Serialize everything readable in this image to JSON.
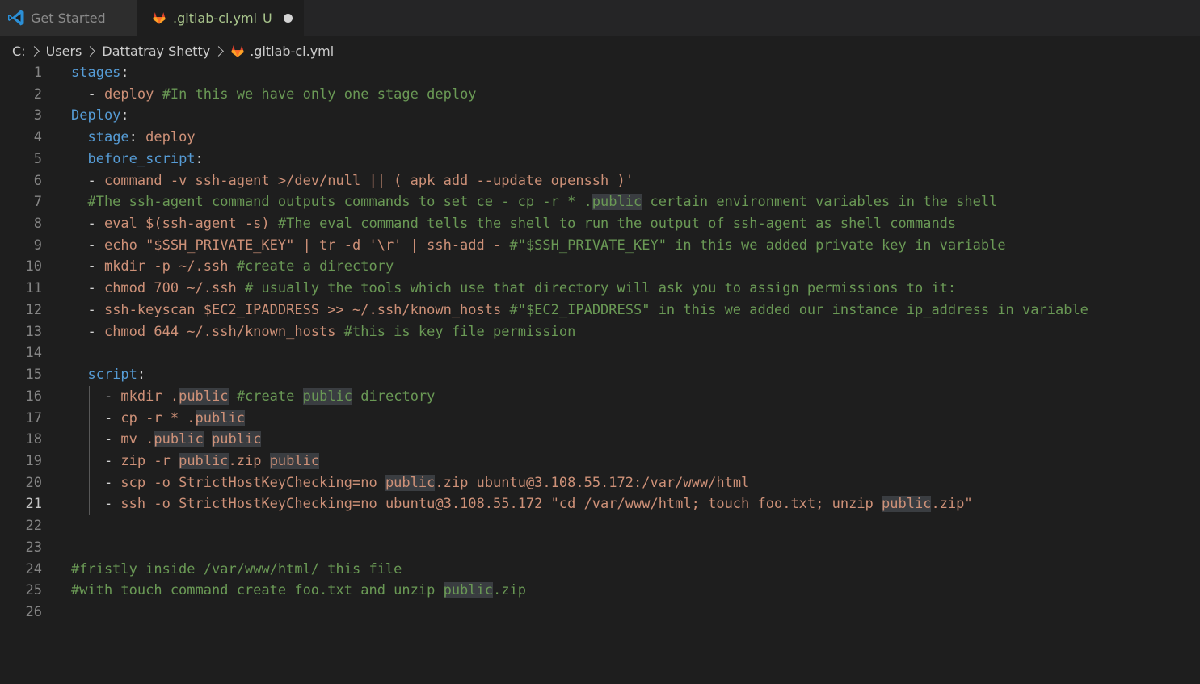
{
  "tabs": [
    {
      "label": "Get Started",
      "active": false,
      "icon": "vscode-icon"
    },
    {
      "label": ".gitlab-ci.yml",
      "status": "U",
      "dirty": true,
      "active": true,
      "icon": "gitlab-icon"
    }
  ],
  "breadcrumb": [
    ".C:",
    "Users",
    "Dattatray Shetty",
    ".gitlab-ci.yml"
  ],
  "editor": {
    "active_line": 21,
    "lines": [
      {
        "n": "1",
        "segs": [
          [
            "k",
            "stages"
          ],
          [
            "p",
            ":"
          ]
        ]
      },
      {
        "n": "2",
        "segs": [
          [
            "p",
            "  - "
          ],
          [
            "s",
            "deploy"
          ],
          [
            "c",
            " #In this we have only one stage deploy"
          ]
        ]
      },
      {
        "n": "3",
        "segs": [
          [
            "k",
            "Deploy"
          ],
          [
            "p",
            ":"
          ]
        ]
      },
      {
        "n": "4",
        "segs": [
          [
            "p",
            "  "
          ],
          [
            "k",
            "stage"
          ],
          [
            "p",
            ": "
          ],
          [
            "s",
            "deploy"
          ]
        ]
      },
      {
        "n": "5",
        "segs": [
          [
            "p",
            "  "
          ],
          [
            "k",
            "before_script"
          ],
          [
            "p",
            ":"
          ]
        ]
      },
      {
        "n": "6",
        "segs": [
          [
            "p",
            "  - "
          ],
          [
            "s",
            "command -v ssh-agent >/dev/null || ( apk add --update openssh )'"
          ]
        ]
      },
      {
        "n": "7",
        "segs": [
          [
            "c",
            "  #The ssh-agent command outputs commands to set ce - cp -r * ."
          ],
          [
            "c hl",
            "public"
          ],
          [
            "c",
            " certain environment variables in the shell"
          ]
        ]
      },
      {
        "n": "8",
        "segs": [
          [
            "p",
            "  - "
          ],
          [
            "s",
            "eval $(ssh-agent -s)"
          ],
          [
            "c",
            " #The eval command tells the shell to run the output of ssh-agent as shell commands"
          ]
        ]
      },
      {
        "n": "9",
        "segs": [
          [
            "p",
            "  - "
          ],
          [
            "s",
            "echo \"$SSH_PRIVATE_KEY\" | tr -d '\\r' | ssh-add -"
          ],
          [
            "c",
            " #\"$SSH_PRIVATE_KEY\" in this we added private key in variable"
          ]
        ]
      },
      {
        "n": "10",
        "segs": [
          [
            "p",
            "  - "
          ],
          [
            "s",
            "mkdir -p ~/.ssh"
          ],
          [
            "c",
            " #create a directory"
          ]
        ]
      },
      {
        "n": "11",
        "segs": [
          [
            "p",
            "  - "
          ],
          [
            "s",
            "chmod 700 ~/.ssh"
          ],
          [
            "c",
            " # usually the tools which use that directory will ask you to assign permissions to it:"
          ]
        ]
      },
      {
        "n": "12",
        "segs": [
          [
            "p",
            "  - "
          ],
          [
            "s",
            "ssh-keyscan $EC2_IPADDRESS >> ~/.ssh/known_hosts"
          ],
          [
            "c",
            " #\"$EC2_IPADDRESS\" in this we added our instance ip_address in variable"
          ]
        ]
      },
      {
        "n": "13",
        "segs": [
          [
            "p",
            "  - "
          ],
          [
            "s",
            "chmod 644 ~/.ssh/known_hosts"
          ],
          [
            "c",
            " #this is key file permission"
          ]
        ]
      },
      {
        "n": "14",
        "segs": []
      },
      {
        "n": "15",
        "segs": [
          [
            "p",
            "  "
          ],
          [
            "k",
            "script"
          ],
          [
            "p",
            ":"
          ]
        ]
      },
      {
        "n": "16",
        "segs": [
          [
            "p",
            "    - "
          ],
          [
            "s",
            "mkdir ."
          ],
          [
            "s hl",
            "public"
          ],
          [
            "c",
            " #create "
          ],
          [
            "c hl",
            "public"
          ],
          [
            "c",
            " directory"
          ]
        ]
      },
      {
        "n": "17",
        "segs": [
          [
            "p",
            "    - "
          ],
          [
            "s",
            "cp -r * ."
          ],
          [
            "s hl",
            "public"
          ]
        ]
      },
      {
        "n": "18",
        "segs": [
          [
            "p",
            "    - "
          ],
          [
            "s",
            "mv ."
          ],
          [
            "s hl",
            "public"
          ],
          [
            "s",
            " "
          ],
          [
            "s hl",
            "public"
          ]
        ]
      },
      {
        "n": "19",
        "segs": [
          [
            "p",
            "    - "
          ],
          [
            "s",
            "zip -r "
          ],
          [
            "s hl",
            "public"
          ],
          [
            "s",
            ".zip "
          ],
          [
            "s hl",
            "public"
          ]
        ]
      },
      {
        "n": "20",
        "segs": [
          [
            "p",
            "    - "
          ],
          [
            "s",
            "scp -o StrictHostKeyChecking=no "
          ],
          [
            "s hl",
            "public"
          ],
          [
            "s",
            ".zip ubuntu@3.108.55.172:/var/www/html"
          ]
        ]
      },
      {
        "n": "21",
        "segs": [
          [
            "p",
            "    - "
          ],
          [
            "s",
            "ssh -o StrictHostKeyChecking=no ubuntu@3.108.55.172 \"cd /var/www/html; touch foo.txt; unzip "
          ],
          [
            "s hl",
            "public"
          ],
          [
            "s",
            ".zip\""
          ]
        ]
      },
      {
        "n": "22",
        "segs": []
      },
      {
        "n": "23",
        "segs": []
      },
      {
        "n": "24",
        "segs": [
          [
            "c",
            "#fristly inside /var/www/html/ this file"
          ]
        ]
      },
      {
        "n": "25",
        "segs": [
          [
            "c",
            "#with touch command create foo.txt and unzip "
          ],
          [
            "c hl",
            "public"
          ],
          [
            "c",
            ".zip"
          ]
        ]
      },
      {
        "n": "26",
        "segs": []
      }
    ]
  }
}
